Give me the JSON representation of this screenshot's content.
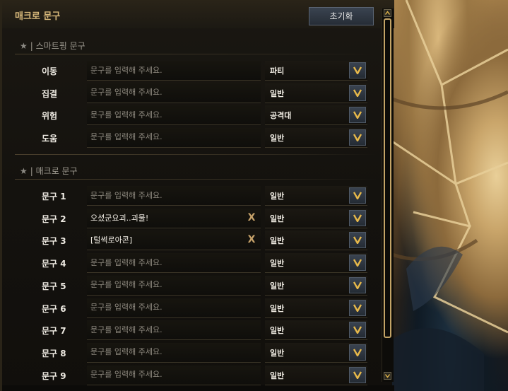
{
  "header": {
    "title": "매크로 문구",
    "reset_label": "초기화"
  },
  "sections": {
    "smart_ping": {
      "star": "★",
      "title": "| 스마트핑 문구"
    },
    "macro": {
      "star": "★",
      "title": "| 매크로 문구"
    }
  },
  "smart_ping_rows": [
    {
      "label": "이동",
      "value": "",
      "placeholder": "문구를 입력해 주세요.",
      "channel": "파티"
    },
    {
      "label": "집결",
      "value": "",
      "placeholder": "문구를 입력해 주세요.",
      "channel": "일반"
    },
    {
      "label": "위험",
      "value": "",
      "placeholder": "문구를 입력해 주세요.",
      "channel": "공격대"
    },
    {
      "label": "도움",
      "value": "",
      "placeholder": "문구를 입력해 주세요.",
      "channel": "일반"
    }
  ],
  "macro_rows": [
    {
      "label": "문구 1",
      "value": "",
      "placeholder": "문구를 입력해 주세요.",
      "channel": "일반"
    },
    {
      "label": "문구 2",
      "value": "오셨군요괴..괴물!",
      "placeholder": "문구를 입력해 주세요.",
      "channel": "일반",
      "clear": "X"
    },
    {
      "label": "문구 3",
      "value": "[털썩로아콘]",
      "placeholder": "문구를 입력해 주세요.",
      "channel": "일반",
      "clear": "X"
    },
    {
      "label": "문구 4",
      "value": "",
      "placeholder": "문구를 입력해 주세요.",
      "channel": "일반"
    },
    {
      "label": "문구 5",
      "value": "",
      "placeholder": "문구를 입력해 주세요.",
      "channel": "일반"
    },
    {
      "label": "문구 6",
      "value": "",
      "placeholder": "문구를 입력해 주세요.",
      "channel": "일반"
    },
    {
      "label": "문구 7",
      "value": "",
      "placeholder": "문구를 입력해 주세요.",
      "channel": "일반"
    },
    {
      "label": "문구 8",
      "value": "",
      "placeholder": "문구를 입력해 주세요.",
      "channel": "일반"
    },
    {
      "label": "문구 9",
      "value": "",
      "placeholder": "문구를 입력해 주세요.",
      "channel": "일반"
    }
  ],
  "icons": {
    "dropdown": "chevron-down-icon",
    "clear": "clear-icon",
    "scroll_up": "arrow-up-icon",
    "scroll_down": "arrow-down-icon"
  },
  "colors": {
    "accent_gold": "#c6a26a",
    "dropdown_chevron": "#e6b84a",
    "title": "#d7b87a"
  }
}
